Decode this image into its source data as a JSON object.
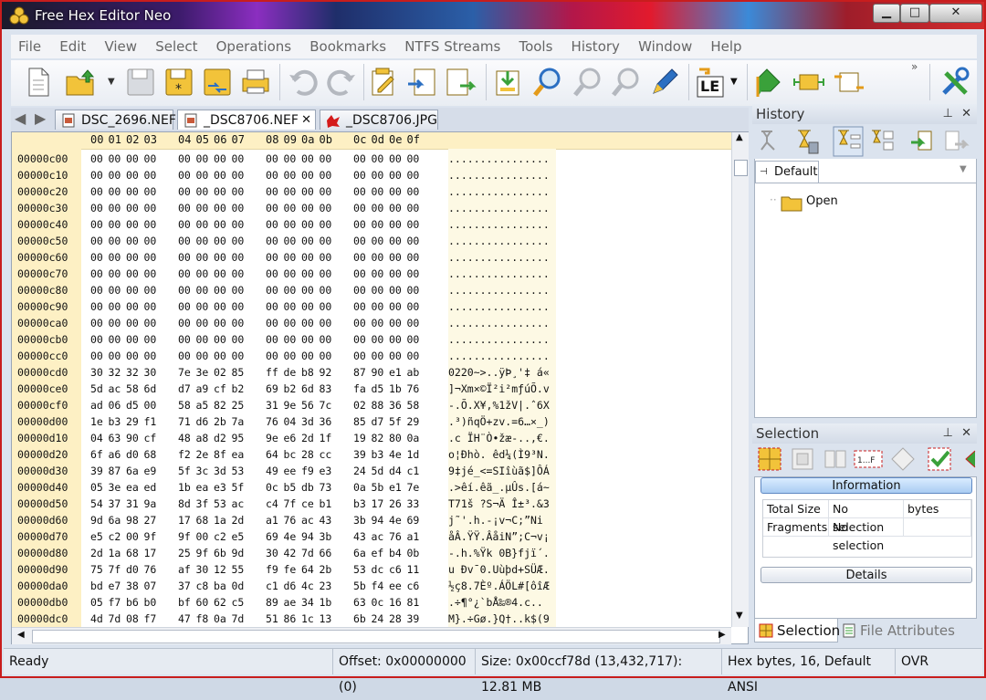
{
  "window": {
    "title": "Free Hex Editor Neo",
    "controls": {
      "minimize": "▁",
      "maximize": "□",
      "close": "✕"
    }
  },
  "menu": [
    "File",
    "Edit",
    "View",
    "Select",
    "Operations",
    "Bookmarks",
    "NTFS Streams",
    "Tools",
    "History",
    "Window",
    "Help"
  ],
  "toolbar": {
    "icons": [
      "new-file-icon",
      "open-file-icon",
      "save-icon",
      "save-as-icon",
      "save-all-icon",
      "print-icon",
      "undo-icon",
      "redo-icon",
      "edit-icon",
      "import-icon",
      "export-icon",
      "insert-file-icon",
      "find-icon",
      "find-next-icon",
      "find-previous-icon",
      "pen-icon",
      "endian-le-icon",
      "bookmark-icon",
      "resize-icon",
      "copy-block-icon",
      "tools-icon"
    ],
    "endian_label": "LE",
    "overflow": "»"
  },
  "tabs": [
    {
      "label": "DSC_2696.NEF",
      "active": false
    },
    {
      "label": "_DSC8706.NEF",
      "active": true,
      "close": "✕"
    },
    {
      "label": "_DSC8706.JPG",
      "active": false
    }
  ],
  "hex": {
    "columns": [
      "00",
      "01",
      "02",
      "03",
      "04",
      "05",
      "06",
      "07",
      "08",
      "09",
      "0a",
      "0b",
      "0c",
      "0d",
      "0e",
      "0f"
    ],
    "rows": [
      {
        "addr": "00000c00",
        "bytes": [
          "00",
          "00",
          "00",
          "00",
          "00",
          "00",
          "00",
          "00",
          "00",
          "00",
          "00",
          "00",
          "00",
          "00",
          "00",
          "00"
        ],
        "ascii": "................"
      },
      {
        "addr": "00000c10",
        "bytes": [
          "00",
          "00",
          "00",
          "00",
          "00",
          "00",
          "00",
          "00",
          "00",
          "00",
          "00",
          "00",
          "00",
          "00",
          "00",
          "00"
        ],
        "ascii": "................"
      },
      {
        "addr": "00000c20",
        "bytes": [
          "00",
          "00",
          "00",
          "00",
          "00",
          "00",
          "00",
          "00",
          "00",
          "00",
          "00",
          "00",
          "00",
          "00",
          "00",
          "00"
        ],
        "ascii": "................"
      },
      {
        "addr": "00000c30",
        "bytes": [
          "00",
          "00",
          "00",
          "00",
          "00",
          "00",
          "00",
          "00",
          "00",
          "00",
          "00",
          "00",
          "00",
          "00",
          "00",
          "00"
        ],
        "ascii": "................"
      },
      {
        "addr": "00000c40",
        "bytes": [
          "00",
          "00",
          "00",
          "00",
          "00",
          "00",
          "00",
          "00",
          "00",
          "00",
          "00",
          "00",
          "00",
          "00",
          "00",
          "00"
        ],
        "ascii": "................"
      },
      {
        "addr": "00000c50",
        "bytes": [
          "00",
          "00",
          "00",
          "00",
          "00",
          "00",
          "00",
          "00",
          "00",
          "00",
          "00",
          "00",
          "00",
          "00",
          "00",
          "00"
        ],
        "ascii": "................"
      },
      {
        "addr": "00000c60",
        "bytes": [
          "00",
          "00",
          "00",
          "00",
          "00",
          "00",
          "00",
          "00",
          "00",
          "00",
          "00",
          "00",
          "00",
          "00",
          "00",
          "00"
        ],
        "ascii": "................"
      },
      {
        "addr": "00000c70",
        "bytes": [
          "00",
          "00",
          "00",
          "00",
          "00",
          "00",
          "00",
          "00",
          "00",
          "00",
          "00",
          "00",
          "00",
          "00",
          "00",
          "00"
        ],
        "ascii": "................"
      },
      {
        "addr": "00000c80",
        "bytes": [
          "00",
          "00",
          "00",
          "00",
          "00",
          "00",
          "00",
          "00",
          "00",
          "00",
          "00",
          "00",
          "00",
          "00",
          "00",
          "00"
        ],
        "ascii": "................"
      },
      {
        "addr": "00000c90",
        "bytes": [
          "00",
          "00",
          "00",
          "00",
          "00",
          "00",
          "00",
          "00",
          "00",
          "00",
          "00",
          "00",
          "00",
          "00",
          "00",
          "00"
        ],
        "ascii": "................"
      },
      {
        "addr": "00000ca0",
        "bytes": [
          "00",
          "00",
          "00",
          "00",
          "00",
          "00",
          "00",
          "00",
          "00",
          "00",
          "00",
          "00",
          "00",
          "00",
          "00",
          "00"
        ],
        "ascii": "................"
      },
      {
        "addr": "00000cb0",
        "bytes": [
          "00",
          "00",
          "00",
          "00",
          "00",
          "00",
          "00",
          "00",
          "00",
          "00",
          "00",
          "00",
          "00",
          "00",
          "00",
          "00"
        ],
        "ascii": "................"
      },
      {
        "addr": "00000cc0",
        "bytes": [
          "00",
          "00",
          "00",
          "00",
          "00",
          "00",
          "00",
          "00",
          "00",
          "00",
          "00",
          "00",
          "00",
          "00",
          "00",
          "00"
        ],
        "ascii": "................"
      },
      {
        "addr": "00000cd0",
        "bytes": [
          "30",
          "32",
          "32",
          "30",
          "7e",
          "3e",
          "02",
          "85",
          "ff",
          "de",
          "b8",
          "92",
          "87",
          "90",
          "e1",
          "ab"
        ],
        "ascii": "0220~>..ÿÞ¸'‡ á«"
      },
      {
        "addr": "00000ce0",
        "bytes": [
          "5d",
          "ac",
          "58",
          "6d",
          "d7",
          "a9",
          "cf",
          "b2",
          "69",
          "b2",
          "6d",
          "83",
          "fa",
          "d5",
          "1b",
          "76"
        ],
        "ascii": "]¬Xm×©Ï²i²mƒúÕ.v"
      },
      {
        "addr": "00000cf0",
        "bytes": [
          "ad",
          "06",
          "d5",
          "00",
          "58",
          "a5",
          "82",
          "25",
          "31",
          "9e",
          "56",
          "7c",
          "02",
          "88",
          "36",
          "58"
        ],
        "ascii": "-.Õ.X¥,%1žV|.ˆ6X"
      },
      {
        "addr": "00000d00",
        "bytes": [
          "1e",
          "b3",
          "29",
          "f1",
          "71",
          "d6",
          "2b",
          "7a",
          "76",
          "04",
          "3d",
          "36",
          "85",
          "d7",
          "5f",
          "29"
        ],
        "ascii": ".³)ñqÖ+zv.=6…×_)"
      },
      {
        "addr": "00000d10",
        "bytes": [
          "04",
          "63",
          "90",
          "cf",
          "48",
          "a8",
          "d2",
          "95",
          "9e",
          "e6",
          "2d",
          "1f",
          "19",
          "82",
          "80",
          "0a"
        ],
        "ascii": ".c ÏH¨Ò•žæ-..,€."
      },
      {
        "addr": "00000d20",
        "bytes": [
          "6f",
          "a6",
          "d0",
          "68",
          "f2",
          "2e",
          "8f",
          "ea",
          "64",
          "bc",
          "28",
          "cc",
          "39",
          "b3",
          "4e",
          "1d"
        ],
        "ascii": "o¦Ðhò. êd¼(Ì9³N."
      },
      {
        "addr": "00000d30",
        "bytes": [
          "39",
          "87",
          "6a",
          "e9",
          "5f",
          "3c",
          "3d",
          "53",
          "49",
          "ee",
          "f9",
          "e3",
          "24",
          "5d",
          "d4",
          "c1"
        ],
        "ascii": "9‡jé_<=SIîùã$]ÔÁ"
      },
      {
        "addr": "00000d40",
        "bytes": [
          "05",
          "3e",
          "ea",
          "ed",
          "1b",
          "ea",
          "e3",
          "5f",
          "0c",
          "b5",
          "db",
          "73",
          "0a",
          "5b",
          "e1",
          "7e"
        ],
        "ascii": ".>êí.êã_.µÛs.[á~"
      },
      {
        "addr": "00000d50",
        "bytes": [
          "54",
          "37",
          "31",
          "9a",
          "8d",
          "3f",
          "53",
          "ac",
          "c4",
          "7f",
          "ce",
          "b1",
          "b3",
          "17",
          "26",
          "33"
        ],
        "ascii": "T71š ?S¬Ä Î±³.&3"
      },
      {
        "addr": "00000d60",
        "bytes": [
          "9d",
          "6a",
          "98",
          "27",
          "17",
          "68",
          "1a",
          "2d",
          "a1",
          "76",
          "ac",
          "43",
          "3b",
          "94",
          "4e",
          "69"
        ],
        "ascii": " j˜'.h.-¡v¬C;”Ni"
      },
      {
        "addr": "00000d70",
        "bytes": [
          "e5",
          "c2",
          "00",
          "9f",
          "9f",
          "00",
          "c2",
          "e5",
          "69",
          "4e",
          "94",
          "3b",
          "43",
          "ac",
          "76",
          "a1"
        ],
        "ascii": "åÂ.ŸŸ.ÂåiN”;C¬v¡"
      },
      {
        "addr": "00000d80",
        "bytes": [
          "2d",
          "1a",
          "68",
          "17",
          "25",
          "9f",
          "6b",
          "9d",
          "30",
          "42",
          "7d",
          "66",
          "6a",
          "ef",
          "b4",
          "0b"
        ],
        "ascii": "-.h.%Ÿk 0B}fjï´."
      },
      {
        "addr": "00000d90",
        "bytes": [
          "75",
          "7f",
          "d0",
          "76",
          "af",
          "30",
          "12",
          "55",
          "f9",
          "fe",
          "64",
          "2b",
          "53",
          "dc",
          "c6",
          "11"
        ],
        "ascii": "u Ðv¯0.Uùþd+SÜÆ."
      },
      {
        "addr": "00000da0",
        "bytes": [
          "bd",
          "e7",
          "38",
          "07",
          "37",
          "c8",
          "ba",
          "0d",
          "c1",
          "d6",
          "4c",
          "23",
          "5b",
          "f4",
          "ee",
          "c6"
        ],
        "ascii": "½ç8.7Èº.ÁÖL#[ôîÆ"
      },
      {
        "addr": "00000db0",
        "bytes": [
          "05",
          "f7",
          "b6",
          "b0",
          "bf",
          "60",
          "62",
          "c5",
          "89",
          "ae",
          "34",
          "1b",
          "63",
          "0c",
          "16",
          "81"
        ],
        "ascii": ".÷¶°¿`bÅ‰®4.c.. "
      },
      {
        "addr": "00000dc0",
        "bytes": [
          "4d",
          "7d",
          "08",
          "f7",
          "47",
          "f8",
          "0a",
          "7d",
          "51",
          "86",
          "1c",
          "13",
          "6b",
          "24",
          "28",
          "39"
        ],
        "ascii": "M}.÷Gø.}Q†..k$(9"
      }
    ]
  },
  "history": {
    "title": "History",
    "pin": "⊥",
    "close": "✕",
    "tab": "Default",
    "items": [
      "Open"
    ]
  },
  "selection": {
    "title": "Selection",
    "pin": "⊥",
    "close": "✕",
    "info_button": "Information",
    "rows": [
      {
        "label": "Total Size",
        "value": "No selection",
        "unit": "bytes"
      },
      {
        "label": "Fragments",
        "value": "No selection",
        "unit": ""
      }
    ],
    "details_button": "Details",
    "bottom_tabs": [
      "Selection",
      "File Attributes"
    ]
  },
  "status": {
    "state": "Ready",
    "offset": "Offset: 0x00000000 (0)",
    "size": "Size: 0x00ccf78d (13,432,717): 12.81 MB",
    "mode": "Hex bytes, 16, Default ANSI",
    "ovr": "OVR"
  },
  "colors": {
    "title_close_red": "#c81d1d",
    "hex_header_bg": "#fdf0c4",
    "ascii_bg": "#fdf9e4",
    "panel_accent": "#5f88c3"
  }
}
